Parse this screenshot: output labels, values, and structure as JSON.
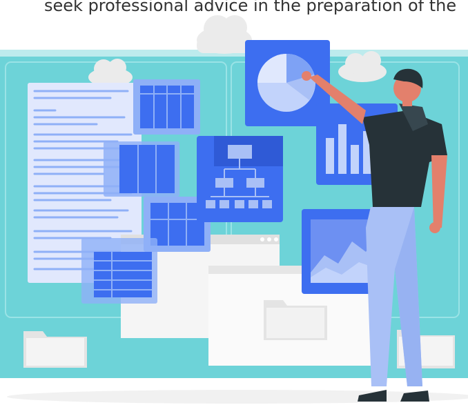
{
  "caption": {
    "text": "seek professional advice in the preparation of the"
  },
  "illustration": {
    "elements": [
      "document-page",
      "table-cards",
      "pie-chart-card",
      "bar-chart-card",
      "org-chart-card",
      "line-chart-card",
      "folders",
      "clouds",
      "person"
    ]
  },
  "colors": {
    "background_teal": "#6dd3d8",
    "card_blue": "#3d6ef0",
    "card_light_blue": "#8fb0f7",
    "document_paper": "#e1e8fd",
    "folder": "#eeeeee",
    "person_shirt": "#263238",
    "person_pants": "#a9c0f6",
    "person_skin": "#e3806c"
  }
}
